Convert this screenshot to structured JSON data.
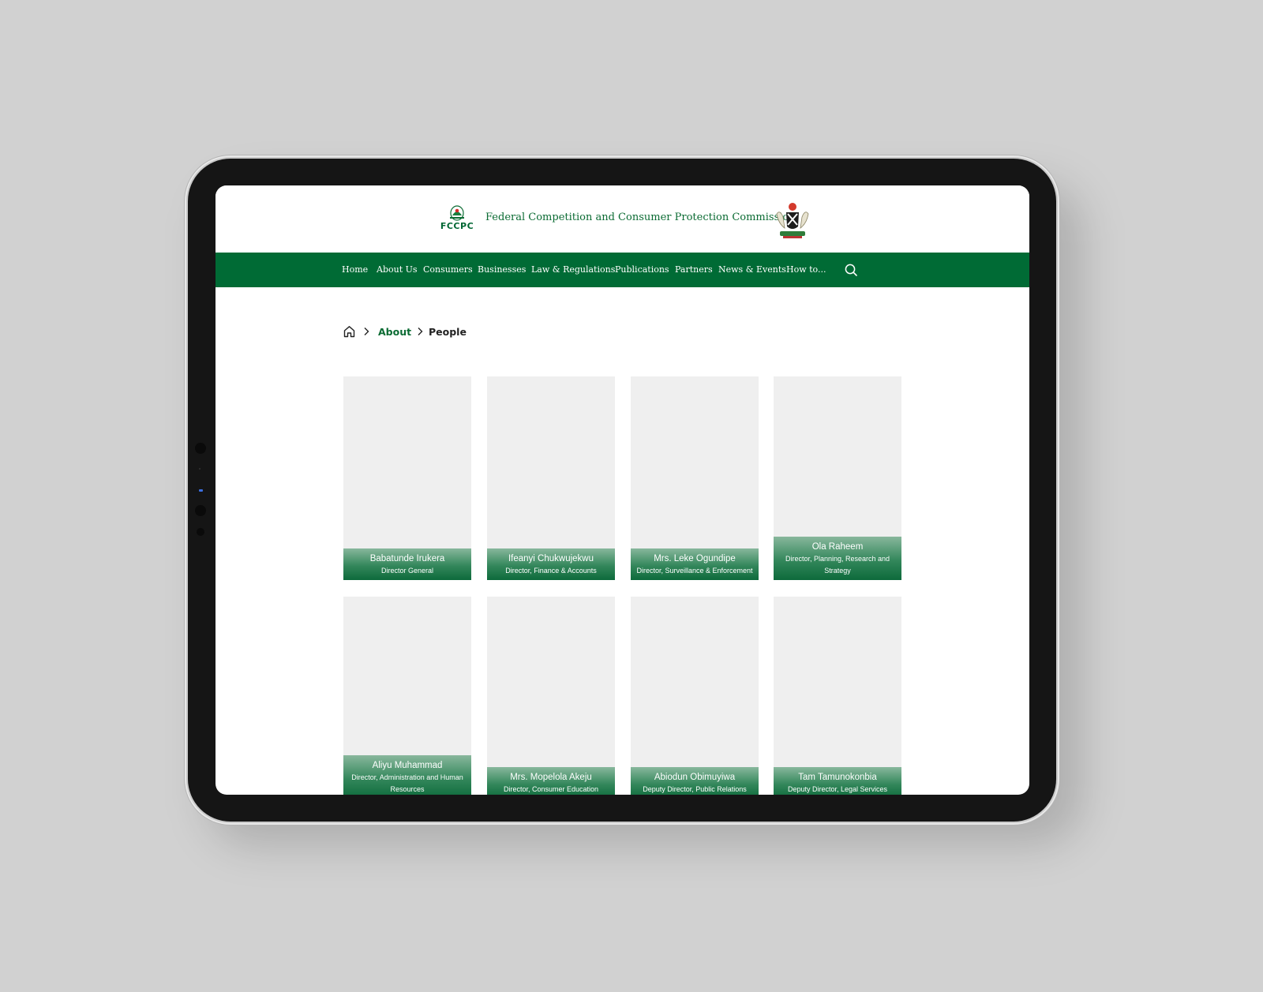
{
  "site": {
    "logo_text": "FCCPC",
    "title": "Federal Competition and Consumer Protection Commission"
  },
  "nav": {
    "items": [
      "Home",
      "About Us",
      "Consumers",
      "Businesses",
      "Law & Regulations",
      "Publications",
      "Partners",
      "News & Events",
      "How to..."
    ],
    "search_icon": "search-icon"
  },
  "breadcrumb": {
    "home_icon": "home-icon",
    "about": "About",
    "current": "People"
  },
  "people": [
    {
      "name": "Babatunde Irukera",
      "role": "Director General"
    },
    {
      "name": "Ifeanyi Chukwujekwu",
      "role": "Director, Finance & Accounts"
    },
    {
      "name": "Mrs. Leke Ogundipe",
      "role": "Director, Surveillance & Enforcement"
    },
    {
      "name": "Ola Raheem",
      "role": "Director, Planning, Research and Strategy"
    },
    {
      "name": "Aliyu Muhammad",
      "role": "Director, Administration and Human Resources"
    },
    {
      "name": "Mrs. Mopelola Akeju",
      "role": "Director, Consumer Education"
    },
    {
      "name": "Abiodun Obimuyiwa",
      "role": "Deputy Director, Public Relations"
    },
    {
      "name": "Tam Tamunokonbia",
      "role": "Deputy Director, Legal Services"
    }
  ],
  "colors": {
    "brand_green": "#006b35",
    "background": "#d1d1d1",
    "card_placeholder": "#efefef"
  }
}
